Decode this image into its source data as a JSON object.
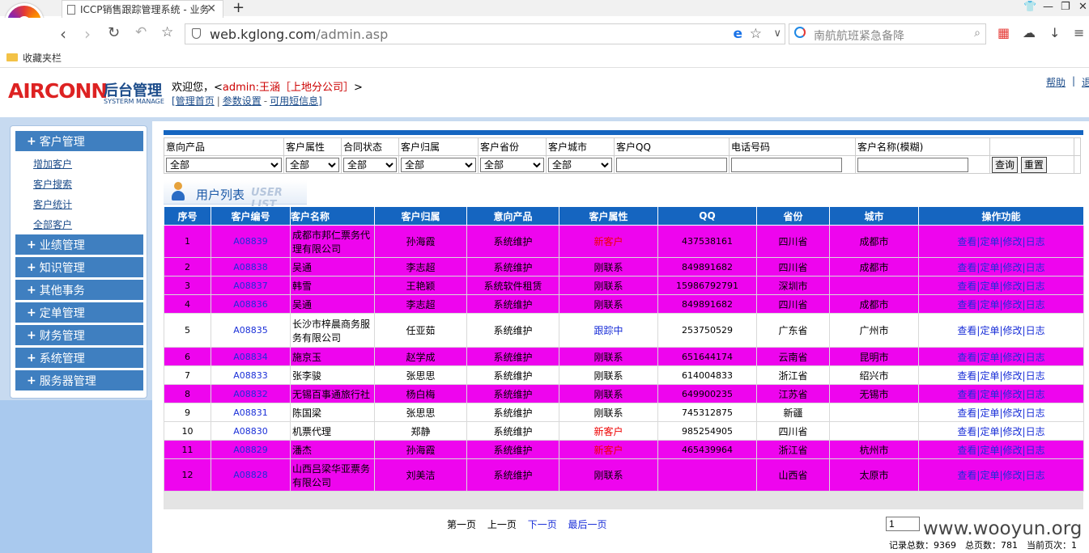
{
  "browser": {
    "tab_title": "ICCP销售跟踪管理系统 - 业务",
    "url_host": "web.kglong.com",
    "url_path": "/admin.asp",
    "search_query": "南航航班紧急备降",
    "favorites_label": "收藏夹栏"
  },
  "header": {
    "brand": "AIRCONN",
    "brand_cn": "后台管理",
    "brand_sub": "SYSTERM MANAGE",
    "welcome_prefix": "欢迎您，<",
    "welcome_user": "admin:王涵［上地分公司］",
    "welcome_suffix": ">",
    "links": [
      "管理首页",
      "参数设置",
      "可用短信息"
    ],
    "help": "帮助",
    "help_sep": "|",
    "exit_partial": "退"
  },
  "sidebar": {
    "sections": [
      {
        "label": "客户管理",
        "items": [
          "增加客户",
          "客户搜索",
          "客户统计",
          "全部客户"
        ]
      },
      {
        "label": "业绩管理"
      },
      {
        "label": "知识管理"
      },
      {
        "label": "其他事务"
      },
      {
        "label": "定单管理"
      },
      {
        "label": "财务管理"
      },
      {
        "label": "系统管理"
      },
      {
        "label": "服务器管理"
      }
    ]
  },
  "filters": {
    "labels": [
      "意向产品",
      "客户属性",
      "合同状态",
      "客户归属",
      "客户省份",
      "客户城市",
      "客户QQ",
      "电话号码",
      "客户名称(模糊)"
    ],
    "select_value": "全部",
    "search_button": "查询",
    "reset_button": "重置"
  },
  "list_title": {
    "cn": "用户列表",
    "en": "USER LIST"
  },
  "table": {
    "columns": [
      "序号",
      "客户编号",
      "客户名称",
      "客户归属",
      "意向产品",
      "客户属性",
      "QQ",
      "省份",
      "城市",
      "操作功能"
    ],
    "ops": [
      "查看",
      "定单",
      "修改",
      "日志"
    ],
    "rows": [
      {
        "no": "1",
        "code": "A08839",
        "name": "成都市邦仁票务代理有限公司",
        "owner": "孙海霞",
        "product": "系统维护",
        "attr": "新客户",
        "qq": "437538161",
        "province": "四川省",
        "city": "成都市"
      },
      {
        "no": "2",
        "code": "A08838",
        "name": "吴通",
        "owner": "李志超",
        "product": "系统维护",
        "attr": "刚联系",
        "qq": "849891682",
        "province": "四川省",
        "city": "成都市"
      },
      {
        "no": "3",
        "code": "A08837",
        "name": "韩雪",
        "owner": "王艳颖",
        "product": "系统软件租赁",
        "attr": "刚联系",
        "qq": "15986792791",
        "province": "深圳市",
        "city": ""
      },
      {
        "no": "4",
        "code": "A08836",
        "name": "吴通",
        "owner": "李志超",
        "product": "系统维护",
        "attr": "刚联系",
        "qq": "849891682",
        "province": "四川省",
        "city": "成都市"
      },
      {
        "no": "5",
        "code": "A08835",
        "name": "长沙市梓晨商务服务有限公司",
        "owner": "任亚茹",
        "product": "系统维护",
        "attr": "跟踪中",
        "qq": "253750529",
        "province": "广东省",
        "city": "广州市"
      },
      {
        "no": "6",
        "code": "A08834",
        "name": "施京玉",
        "owner": "赵学成",
        "product": "系统维护",
        "attr": "刚联系",
        "qq": "651644174",
        "province": "云南省",
        "city": "昆明市"
      },
      {
        "no": "7",
        "code": "A08833",
        "name": "张李骏",
        "owner": "张思思",
        "product": "系统维护",
        "attr": "刚联系",
        "qq": "614004833",
        "province": "浙江省",
        "city": "绍兴市"
      },
      {
        "no": "8",
        "code": "A08832",
        "name": "无锡百事通旅行社",
        "owner": "杨白梅",
        "product": "系统维护",
        "attr": "刚联系",
        "qq": "649900235",
        "province": "江苏省",
        "city": "无锡市"
      },
      {
        "no": "9",
        "code": "A08831",
        "name": "陈国梁",
        "owner": "张思思",
        "product": "系统维护",
        "attr": "刚联系",
        "qq": "745312875",
        "province": "新疆",
        "city": ""
      },
      {
        "no": "10",
        "code": "A08830",
        "name": "机票代理",
        "owner": "郑静",
        "product": "系统维护",
        "attr": "新客户",
        "qq": "985254905",
        "province": "四川省",
        "city": ""
      },
      {
        "no": "11",
        "code": "A08829",
        "name": "潘杰",
        "owner": "孙海霞",
        "product": "系统维护",
        "attr": "新客户",
        "qq": "465439964",
        "province": "浙江省",
        "city": "杭州市"
      },
      {
        "no": "12",
        "code": "A08828",
        "name": "山西吕梁华亚票务有限公司",
        "owner": "刘美洁",
        "product": "系统维护",
        "attr": "刚联系",
        "qq": "",
        "province": "山西省",
        "city": "太原市"
      }
    ]
  },
  "pager": {
    "first": "第一页",
    "prev": "上一页",
    "next": "下一页",
    "last": "最后一页",
    "page_input": "1",
    "stats": "记录总数：9369　总页数：781　当前页次：1"
  },
  "watermark": "www.wooyun.org",
  "colors": {
    "row_magenta": "#ee05ee",
    "header_blue": "#1565c0",
    "link_blue": "#1a2fd8",
    "new_red": "#e00"
  }
}
